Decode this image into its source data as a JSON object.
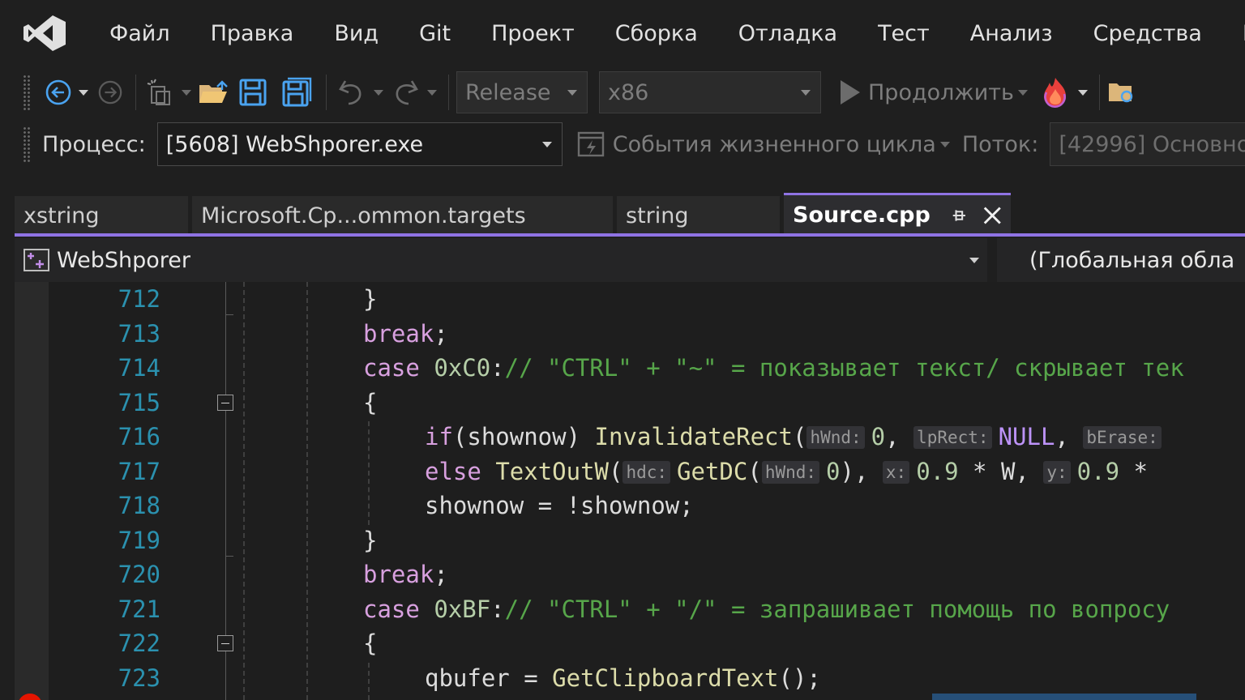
{
  "menu": {
    "items": [
      "Файл",
      "Правка",
      "Вид",
      "Git",
      "Проект",
      "Сборка",
      "Отладка",
      "Тест",
      "Анализ",
      "Средства",
      "Расши"
    ]
  },
  "toolbar": {
    "configuration": "Release",
    "platform": "x86",
    "continue_label": "Продолжить"
  },
  "debug_location": {
    "process_label": "Процесс:",
    "process_value": "[5608] WebShporer.exe",
    "lifecycle_label": "События жизненного цикла",
    "thread_label": "Поток:",
    "thread_value": "[42996] Основно"
  },
  "tabs": [
    {
      "label": "xstring",
      "active": false
    },
    {
      "label": "Microsoft.Cp...ommon.targets",
      "active": false
    },
    {
      "label": "string",
      "active": false
    },
    {
      "label": "Source.cpp",
      "active": true
    }
  ],
  "navbar": {
    "project": "WebShporer",
    "scope": "(Глобальная обла"
  },
  "editor": {
    "lines": [
      {
        "num": "712",
        "tokens": [
          {
            "t": "}",
            "c": "txt"
          }
        ]
      },
      {
        "num": "713",
        "tokens": [
          {
            "t": "break",
            "c": "kw"
          },
          {
            "t": ";",
            "c": "txt"
          }
        ]
      },
      {
        "num": "714",
        "tokens": [
          {
            "t": "case ",
            "c": "kw"
          },
          {
            "t": "0xC0",
            "c": "num"
          },
          {
            "t": ":",
            "c": "txt"
          },
          {
            "t": "// \"CTRL\" + \"~\" = показывает текст/ скрывает тек",
            "c": "cm"
          }
        ]
      },
      {
        "num": "715",
        "tokens": [
          {
            "t": "{",
            "c": "txt"
          }
        ]
      },
      {
        "num": "716",
        "tokens": [
          {
            "t": "if",
            "c": "kw"
          },
          {
            "t": "(shownow) ",
            "c": "txt"
          },
          {
            "t": "InvalidateRect",
            "c": "fn"
          },
          {
            "t": "(",
            "c": "txt"
          },
          {
            "t": "hWnd:",
            "c": "hint"
          },
          {
            "t": "0",
            "c": "num"
          },
          {
            "t": ", ",
            "c": "txt"
          },
          {
            "t": "lpRect:",
            "c": "hint"
          },
          {
            "t": "NULL",
            "c": "mac"
          },
          {
            "t": ", ",
            "c": "txt"
          },
          {
            "t": "bErase:",
            "c": "hint"
          }
        ]
      },
      {
        "num": "717",
        "tokens": [
          {
            "t": "else ",
            "c": "kw"
          },
          {
            "t": "TextOutW",
            "c": "fn"
          },
          {
            "t": "(",
            "c": "txt"
          },
          {
            "t": "hdc:",
            "c": "hint"
          },
          {
            "t": "GetDC",
            "c": "fn"
          },
          {
            "t": "(",
            "c": "txt"
          },
          {
            "t": "hWnd:",
            "c": "hint"
          },
          {
            "t": "0",
            "c": "num"
          },
          {
            "t": "), ",
            "c": "txt"
          },
          {
            "t": "x:",
            "c": "hint"
          },
          {
            "t": "0.9",
            "c": "num"
          },
          {
            "t": " * W, ",
            "c": "txt"
          },
          {
            "t": "y:",
            "c": "hint"
          },
          {
            "t": "0.9",
            "c": "num"
          },
          {
            "t": " * ",
            "c": "txt"
          }
        ]
      },
      {
        "num": "718",
        "tokens": [
          {
            "t": "shownow = !shownow;",
            "c": "txt"
          }
        ]
      },
      {
        "num": "719",
        "tokens": [
          {
            "t": "}",
            "c": "txt"
          }
        ]
      },
      {
        "num": "720",
        "tokens": [
          {
            "t": "break",
            "c": "kw"
          },
          {
            "t": ";",
            "c": "txt"
          }
        ]
      },
      {
        "num": "721",
        "tokens": [
          {
            "t": "case ",
            "c": "kw"
          },
          {
            "t": "0xBF",
            "c": "num"
          },
          {
            "t": ":",
            "c": "txt"
          },
          {
            "t": "// \"CTRL\" + \"/\" = запрашивает помощь по вопросу",
            "c": "cm"
          }
        ]
      },
      {
        "num": "722",
        "tokens": [
          {
            "t": "{",
            "c": "txt"
          }
        ]
      },
      {
        "num": "723",
        "tokens": [
          {
            "t": "qbufer = ",
            "c": "txt"
          },
          {
            "t": "GetClipboardText",
            "c": "fn"
          },
          {
            "t": "();",
            "c": "txt"
          }
        ]
      }
    ]
  },
  "colors": {
    "accent": "#8f73e4",
    "line_number": "#2b91af",
    "keyword": "#d8a0df",
    "comment": "#57a64a",
    "function": "#dcdcaa",
    "number": "#b5cea8",
    "breakpoint": "#e51400"
  }
}
